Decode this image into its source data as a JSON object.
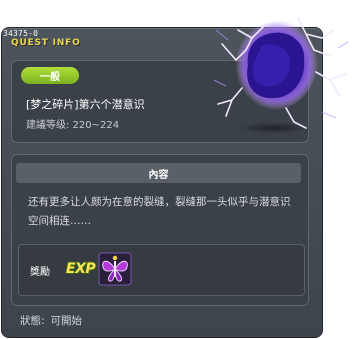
{
  "quest": {
    "id_text": "34375-0",
    "window_title": "QUEST INFO",
    "tag": "一般",
    "name": "[梦之碎片]第六个潜意识",
    "level_text": "建議等级: 220~224"
  },
  "content": {
    "header": "內容",
    "description": "还有更多让人颇为在意的裂缝，裂缝那一头似乎与潜意识空间相连……"
  },
  "reward": {
    "label": "獎勵",
    "exp_text": "EXP"
  },
  "status": {
    "label": "狀態:",
    "value": "可開始"
  },
  "colors": {
    "accent_title": "#e9d64a",
    "tag_green": "#8cc528",
    "window_bg": "#474e55"
  },
  "icons": {
    "quest_art": "purple-crack-orb-icon",
    "reward_item": "purple-butterfly-icon"
  }
}
